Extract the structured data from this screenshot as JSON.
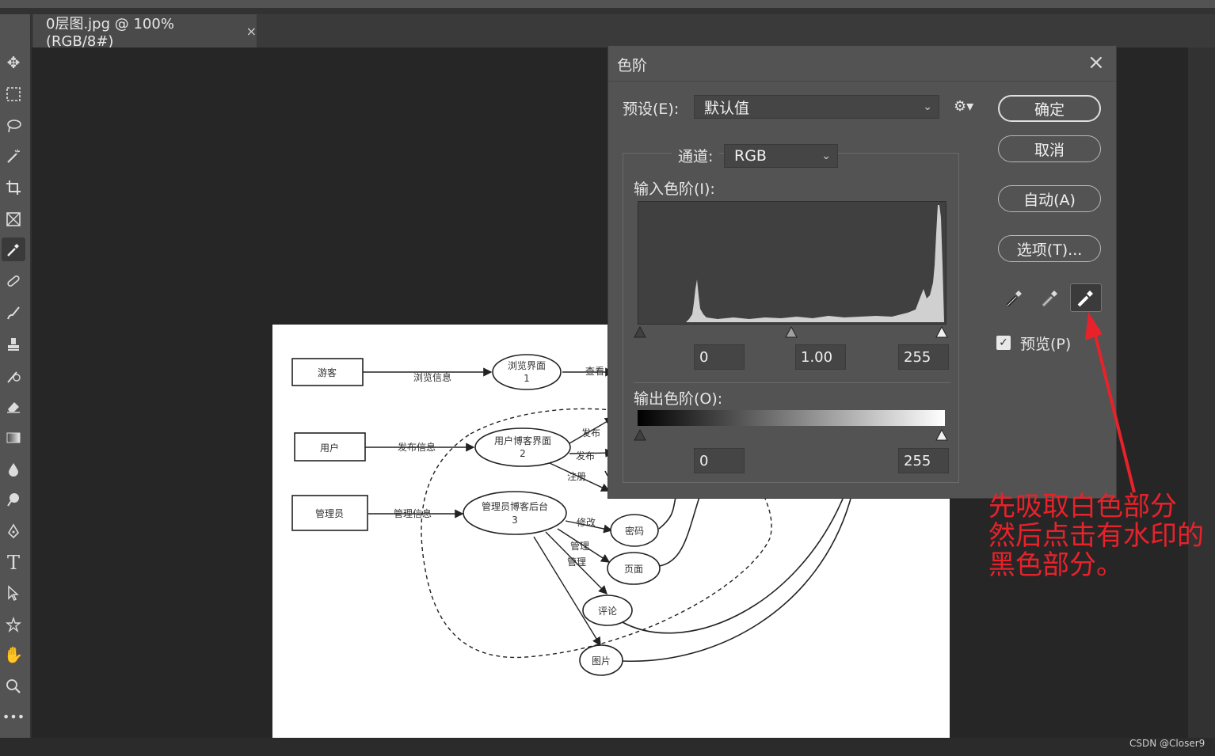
{
  "app": {
    "tab_title": "0层图.jpg @ 100%(RGB/8#)",
    "tab_close": "×"
  },
  "dialog": {
    "title": "色阶",
    "close": "×",
    "preset_label": "预设(E):",
    "preset_value": "默认值",
    "channel_label": "通道:",
    "channel_value": "RGB",
    "input_levels_label": "输入色阶(I):",
    "input_black": "0",
    "input_gamma": "1.00",
    "input_white": "255",
    "output_levels_label": "输出色阶(O):",
    "output_black": "0",
    "output_white": "255",
    "buttons": {
      "ok": "确定",
      "cancel": "取消",
      "auto": "自动(A)",
      "options": "选项(T)..."
    },
    "preview_label": "预览(P)",
    "preview_checked": true
  },
  "diagram": {
    "nodes": {
      "visitor": "游客",
      "user": "用户",
      "admin": "管理员",
      "browse_ui": "浏览界面",
      "browse_ui_num": "1",
      "user_blog_ui": "用户博客界面",
      "user_blog_ui_num": "2",
      "admin_backend": "管理员博客后台",
      "admin_backend_num": "3",
      "password": "密码",
      "page": "页面",
      "comment": "评论",
      "picture": "图片"
    },
    "edges": {
      "browse_info": "浏览信息",
      "view": "查看",
      "post_info": "发布信息",
      "publish1": "发布",
      "publish2": "发布",
      "register": "注册",
      "manage_info": "管理信息",
      "modify": "修改",
      "manage1": "管理",
      "manage2": "管理"
    }
  },
  "annotation": {
    "line1": "先吸取白色部分",
    "line2": "然后点击有水印的",
    "line3": "黑色部分。",
    "color": "#e8222a"
  },
  "watermark": "CSDN @Closer9"
}
